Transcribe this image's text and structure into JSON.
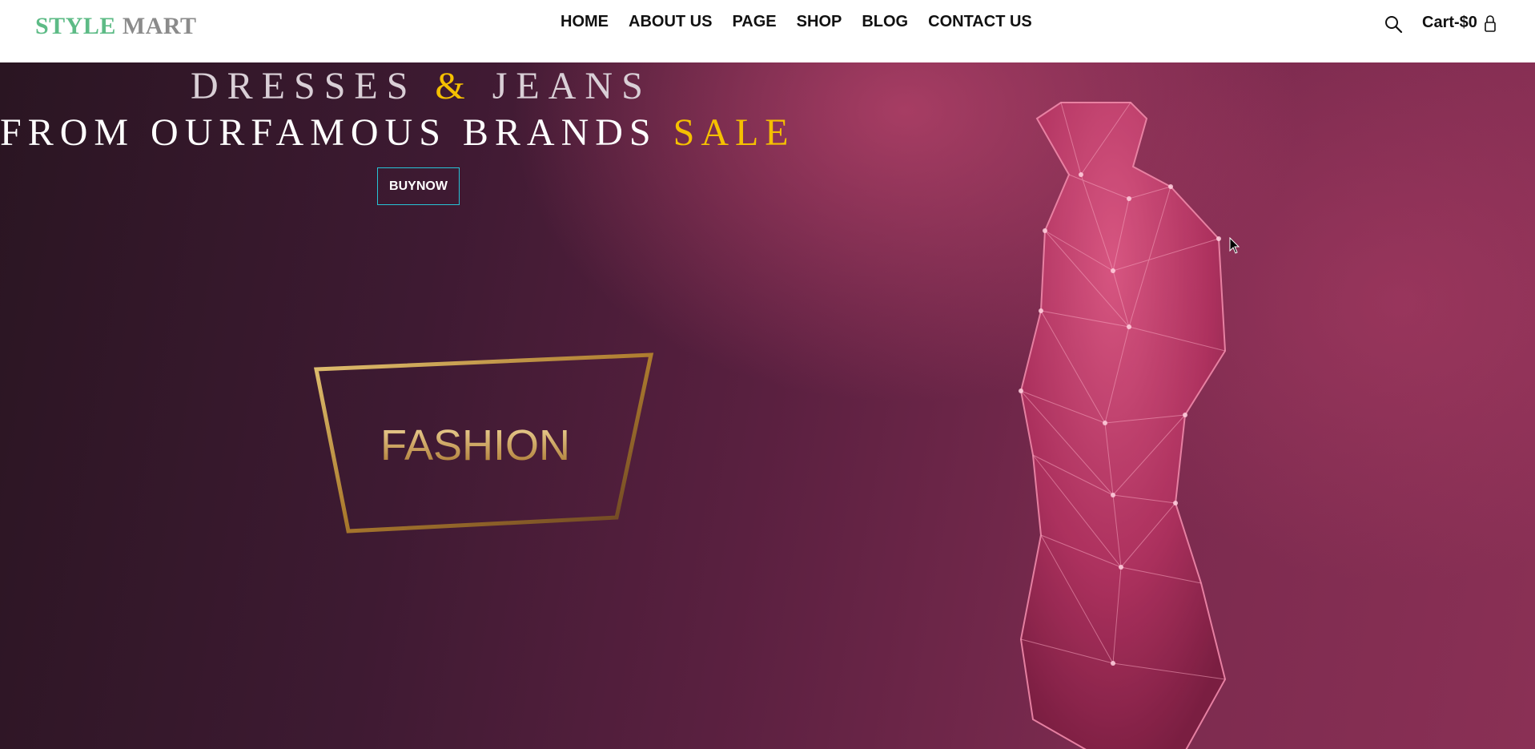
{
  "header": {
    "logo": {
      "part1": "STYLE",
      "part2": "MART"
    },
    "nav": [
      "HOME",
      "ABOUT US",
      "PAGE",
      "SHOP",
      "BLOG",
      "CONTACT US"
    ],
    "search_icon": "search-icon",
    "cart_label": "Cart-$0",
    "lock_icon": "lock-icon"
  },
  "hero": {
    "line1": {
      "a": "DRESSES",
      "amp": "&",
      "b": "JEANS"
    },
    "line2": {
      "a": "FROM OURFAMOUS BRANDS",
      "sale": "SALE"
    },
    "button": "BUYNOW",
    "art_text": "FASHION"
  },
  "colors": {
    "logo_green": "#5dbb86",
    "logo_gray": "#8b8b8b",
    "accent_yellow": "#f5c000",
    "button_border": "#27c3d6",
    "hero_dark": "#2a1522",
    "hero_pink": "#8a3055"
  }
}
